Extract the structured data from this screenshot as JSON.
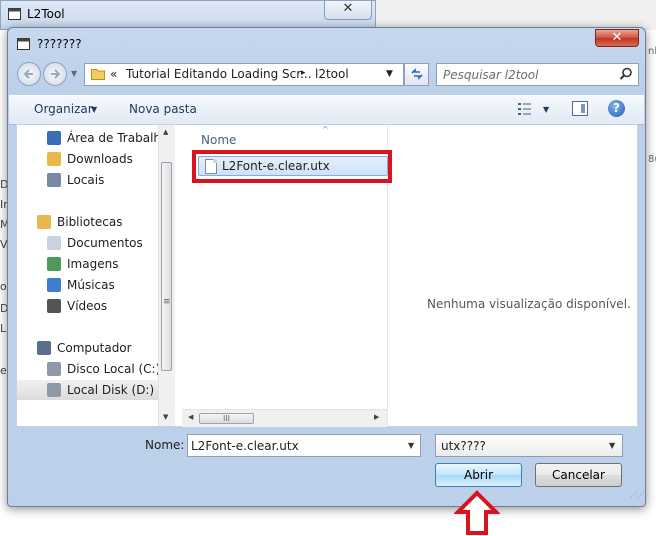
{
  "background_window": {
    "title": "L2Tool",
    "close_symbol": "✕",
    "edge_letters": [
      "D",
      "Ir",
      "M",
      "V",
      "o",
      "D",
      "L",
      "ec"
    ],
    "right_edge_texts": [
      "nl",
      "8("
    ]
  },
  "dialog": {
    "title": "???????",
    "close_symbol": "✕"
  },
  "address": {
    "chevron": "«",
    "crumb1": "Tutorial Editando Loading Scr...",
    "separator": "▸",
    "crumb2": "l2tool",
    "dropdown": "▼"
  },
  "search": {
    "placeholder": "Pesquisar l2tool"
  },
  "toolbar": {
    "organizar_label": "Organizar",
    "organizar_arrow": "▼",
    "nova_pasta_label": "Nova pasta",
    "view_arrow": "▼",
    "help_label": "?"
  },
  "nav_pane": {
    "items": [
      {
        "label": "Área de Trabalho",
        "icon": "desktop-icon"
      },
      {
        "label": "Downloads",
        "icon": "downloads-folder-icon"
      },
      {
        "label": "Locais",
        "icon": "recent-places-icon"
      },
      {
        "label": "Bibliotecas",
        "icon": "libraries-icon"
      },
      {
        "label": "Documentos",
        "icon": "documents-icon"
      },
      {
        "label": "Imagens",
        "icon": "pictures-icon"
      },
      {
        "label": "Músicas",
        "icon": "music-icon"
      },
      {
        "label": "Vídeos",
        "icon": "videos-icon"
      },
      {
        "label": "Computador",
        "icon": "computer-icon"
      },
      {
        "label": "Disco Local (C:)",
        "icon": "drive-c-icon"
      },
      {
        "label": "Local Disk (D:)",
        "icon": "drive-d-icon",
        "selected": true
      }
    ],
    "scroll_up": "▲",
    "scroll_down": "▼",
    "grip": "≡"
  },
  "files_pane": {
    "column_name": "Nome",
    "sort_arrow": "^",
    "files": [
      {
        "name": "L2Font-e.clear.utx",
        "selected": true
      }
    ],
    "hscroll_left": "◀",
    "hscroll_right": "▶",
    "hscroll_grip": "III"
  },
  "preview_pane": {
    "message": "Nenhuma visualização disponível."
  },
  "footer": {
    "name_label": "Nome:",
    "filename_value": "L2Font-e.clear.utx",
    "filename_dropdown": "▼",
    "filetype_value": "utx????",
    "filetype_dropdown": "▼",
    "open_label": "Abrir",
    "cancel_label": "Cancelar",
    "resize_grip": "⋰⋰"
  },
  "annotations": {
    "highlight_color": "#d8141d",
    "arrow_color": "#d8141d"
  }
}
